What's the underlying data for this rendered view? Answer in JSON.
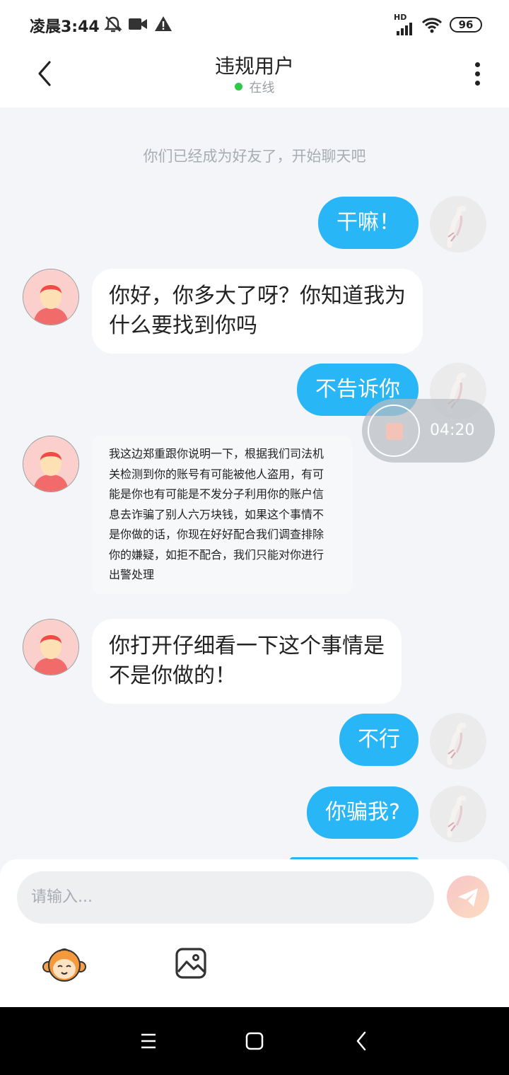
{
  "status_bar": {
    "time": "凌晨3:44",
    "network": "HD",
    "battery": "96"
  },
  "header": {
    "title": "违规用户",
    "status": "在线"
  },
  "system_message": "你们已经成为好友了，开始聊天吧",
  "messages": [
    {
      "sender": "self",
      "text": "干嘛！"
    },
    {
      "sender": "other",
      "text": "你好，你多大了呀？你知道我为\n什么要找到你吗"
    },
    {
      "sender": "self",
      "text": "不告诉你"
    },
    {
      "sender": "other",
      "text": "我这边郑重跟你说明一下，根据我们司法机\n关检测到你的账号有可能被他人盗用，有可\n能是你也有可能是不发分子利用你的账户信\n息去诈骗了别人六万块钱，如果这个事情不\n是你做的话，你现在好好配合我们调查排除\n你的嫌疑，如拒不配合，我们只能对你进行\n出警处理"
    },
    {
      "sender": "other",
      "text": "你打开仔细看一下这个事情是\n不是你做的！"
    },
    {
      "sender": "self",
      "text": "不行"
    },
    {
      "sender": "self",
      "text": "你骗我?"
    }
  ],
  "recording": {
    "time": "04:20"
  },
  "input": {
    "placeholder": "请输入..."
  },
  "colors": {
    "self_bubble": "#28b6f6",
    "online_dot": "#2ec946",
    "background": "#f3f5f8"
  },
  "icons": {
    "back": "chevron-left-icon",
    "more": "more-vertical-icon",
    "send": "paper-plane-icon",
    "emoji": "monkey-emoji-icon",
    "image": "image-icon"
  }
}
